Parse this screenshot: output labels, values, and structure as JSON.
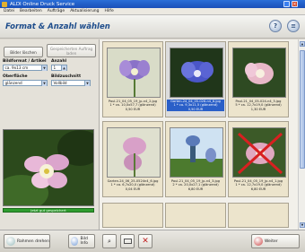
{
  "window": {
    "title": "ALDI Online Druck Service"
  },
  "menu": [
    "Datei",
    "Bearbeiten",
    "Aufträge",
    "Aktualisierung",
    "Hilfe"
  ],
  "header": {
    "title": "Format & Anzahl wählen"
  },
  "left": {
    "delete_button": "Bilder löschen",
    "save_order_button": "Gespeicherten Auftrag laden",
    "format_label": "Bildformat / Artikel",
    "format_value": "ca. 9x13 cm",
    "quantity_label": "Anzahl",
    "quantity_value": "1",
    "surface_label": "Oberfläche",
    "surface_value": "glänzend",
    "cut_label": "Bildzuschnitt",
    "cut_value": "Vollbild",
    "progress_text": "Jetzt gut gespeichert"
  },
  "gallery": {
    "tiles": [
      {
        "name": "Paul-21_04_05_19_jp-n4_2.jpg",
        "line2": "1 * ca. 10,0x57,7 (glänzend)",
        "price": "0,50 EUR",
        "selected": false
      },
      {
        "name": "Garten-24_04_05-026-n4_6.jpg",
        "line2": "1 * ca. 9,3x11,5 (glänzend)",
        "price": "0,50 EUR",
        "selected": true
      },
      {
        "name": "Paul-21_04_05-024-n4_5.jpg",
        "line2": "5 * ca. 12,7x19,0 (glänzend)",
        "price": "1,30 EUR",
        "selected": false
      },
      {
        "name": "Garten-24_06_25-0524n4_6.jpg",
        "line2": "1 * ca. 6,7x20,0 (glänzend)",
        "price": "0,04 EUR",
        "selected": false
      },
      {
        "name": "Paul-21_04_05_19_jp-n4_3.jpg",
        "line2": "2 * ca. 20,0x27,1 (glänzend)",
        "price": "6,80 EUR",
        "selected": false
      },
      {
        "name": "Paul-21_04_05_19_jp-n4_1.jpg",
        "line2": "1 * ca. 12,7x19,0 (glänzend)",
        "price": "6,80 EUR",
        "selected": false
      }
    ]
  },
  "bottom": {
    "rotate_label": "Rahmen drehen",
    "info_label": "Bild Info",
    "next_label": "Weiter"
  },
  "colors": {
    "title_blue": "#1e4d8c",
    "accent_blue": "#2a5fc8",
    "progress_green": "#2f9d2f"
  }
}
